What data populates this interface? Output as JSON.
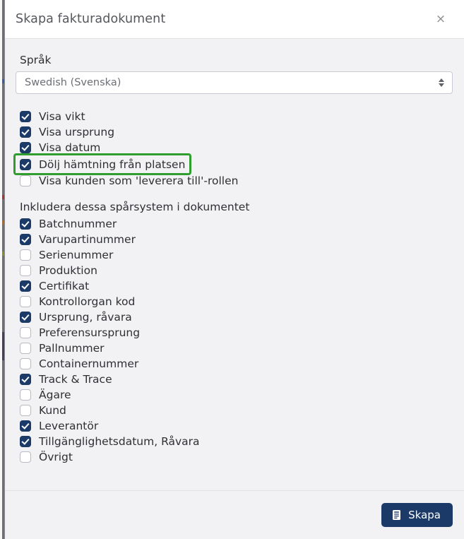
{
  "dialog": {
    "title": "Skapa fakturadokument",
    "close_label": "×",
    "close_icon": "close-icon"
  },
  "language_field": {
    "label": "Språk",
    "selected": "Swedish (Svenska)",
    "options": [
      "Swedish (Svenska)"
    ],
    "arrow_icon": "updown-chevrons-icon"
  },
  "display_options": [
    {
      "label": "Visa vikt",
      "checked": true,
      "highlighted": false
    },
    {
      "label": "Visa ursprung",
      "checked": true,
      "highlighted": false
    },
    {
      "label": "Visa datum",
      "checked": true,
      "highlighted": false
    },
    {
      "label": "Dölj hämtning från platsen",
      "checked": true,
      "highlighted": true
    },
    {
      "label": "Visa kunden som 'leverera till'-rollen",
      "checked": false,
      "highlighted": false
    }
  ],
  "tracking_section": {
    "heading": "Inkludera dessa spårsystem i dokumentet",
    "options": [
      {
        "label": "Batchnummer",
        "checked": true
      },
      {
        "label": "Varupartinummer",
        "checked": true
      },
      {
        "label": "Serienummer",
        "checked": false
      },
      {
        "label": "Produktion",
        "checked": false
      },
      {
        "label": "Certifikat",
        "checked": true
      },
      {
        "label": "Kontrollorgan kod",
        "checked": false
      },
      {
        "label": "Ursprung, råvara",
        "checked": true
      },
      {
        "label": "Preferensursprung",
        "checked": false
      },
      {
        "label": "Pallnummer",
        "checked": false
      },
      {
        "label": "Containernummer",
        "checked": false
      },
      {
        "label": "Track & Trace",
        "checked": true
      },
      {
        "label": "Ägare",
        "checked": false
      },
      {
        "label": "Kund",
        "checked": false
      },
      {
        "label": "Leverantör",
        "checked": true
      },
      {
        "label": "Tillgänglighetsdatum, Råvara",
        "checked": true
      },
      {
        "label": "Övrigt",
        "checked": false
      }
    ]
  },
  "footer": {
    "create_label": "Skapa",
    "create_icon": "document-icon"
  },
  "colors": {
    "accent_navy": "#1c3a68",
    "highlight_green": "#2f9e2f",
    "dialog_bg": "#f2f2f4",
    "header_bg": "#ffffff",
    "text": "#2f3034"
  }
}
